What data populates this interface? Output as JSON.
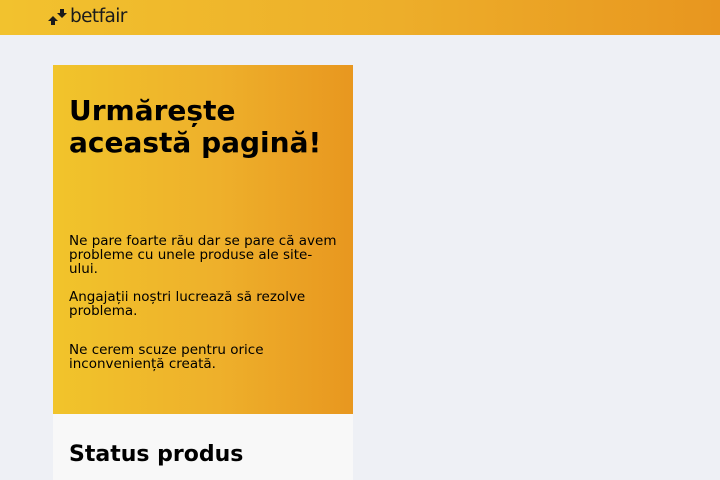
{
  "header": {
    "brand_name": "betfair",
    "brand_colors": [
      "#f2c22e",
      "#e8961f"
    ]
  },
  "notice": {
    "title": "Urmărește această pagină!",
    "paragraphs": [
      "Ne pare foarte rău dar se pare că avem probleme cu unele produse ale site-ului.",
      "Angajații noștri lucrează să rezolve problema.",
      "Ne cerem scuze pentru orice inconveniență creată."
    ]
  },
  "status": {
    "title": "Status produs"
  }
}
